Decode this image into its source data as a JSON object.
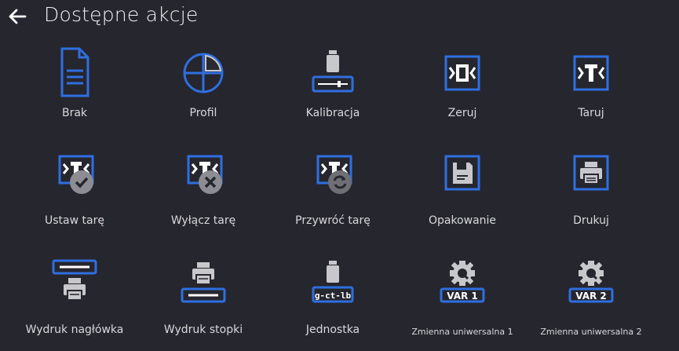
{
  "header": {
    "title": "Dostępne akcje"
  },
  "actions": [
    {
      "label": "Brak"
    },
    {
      "label": "Profil"
    },
    {
      "label": "Kalibracja"
    },
    {
      "label": "Zeruj"
    },
    {
      "label": "Taruj"
    },
    {
      "label": "Ustaw tarę"
    },
    {
      "label": "Wyłącz tarę"
    },
    {
      "label": "Przywróć tarę"
    },
    {
      "label": "Opakowanie"
    },
    {
      "label": "Drukuj"
    },
    {
      "label": "Wydruk nagłówka"
    },
    {
      "label": "Wydruk stopki"
    },
    {
      "label": "Jednostka",
      "badge": "g-ct-lb"
    },
    {
      "label": "Zmienna uniwersalna 1",
      "badge": "VAR 1"
    },
    {
      "label": "Zmienna uniwersalna 2",
      "badge": "VAR 2"
    }
  ],
  "colors": {
    "background": "#26262e",
    "accent": "#2f6fe0",
    "icon_gray": "#c8c8cc",
    "overlay_gray": "#8c8c92"
  }
}
